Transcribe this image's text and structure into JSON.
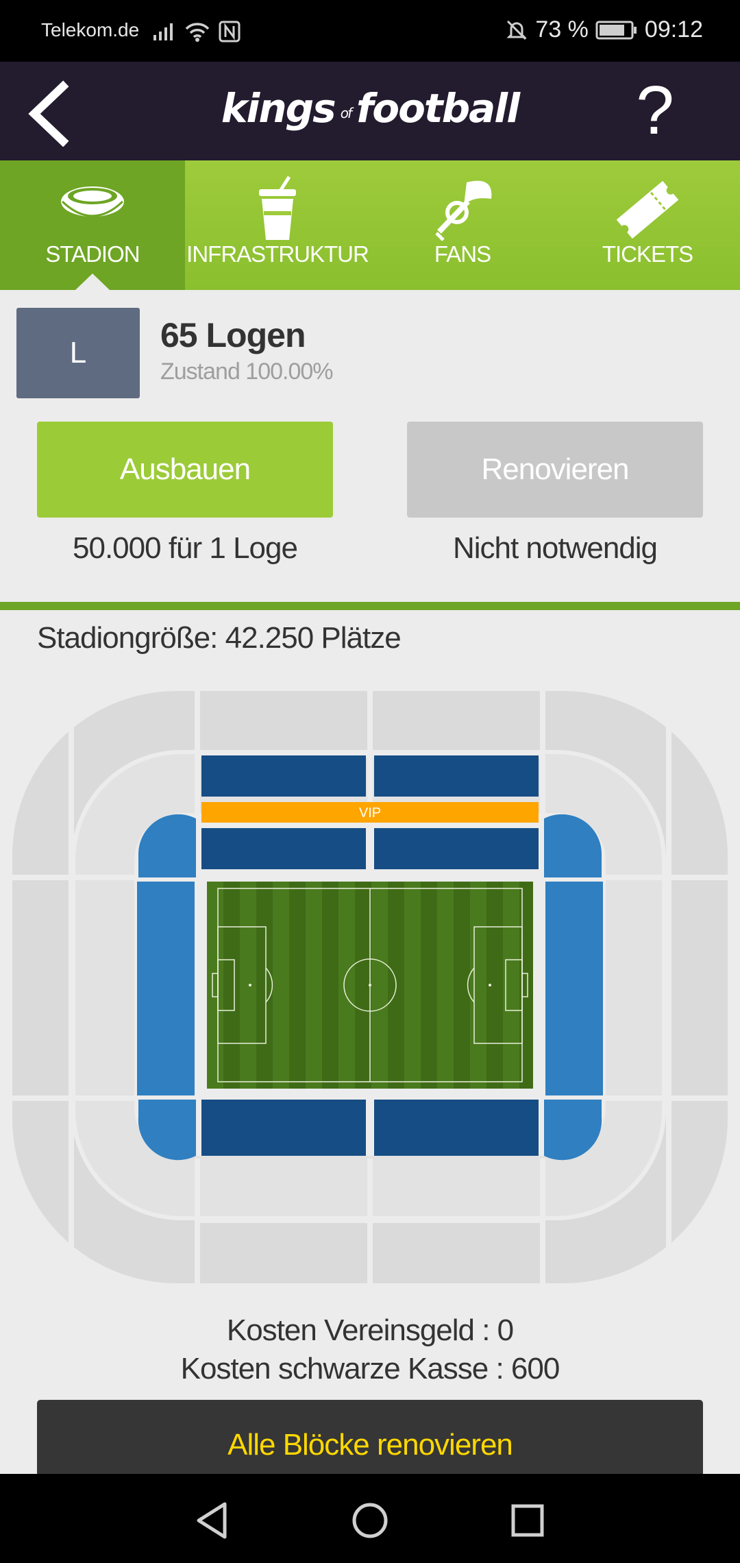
{
  "status_bar": {
    "carrier": "Telekom.de",
    "battery": "73 %",
    "time": "09:12",
    "icons": [
      "signal-icon",
      "wifi-icon",
      "nfc-icon",
      "mute-icon",
      "battery-icon"
    ]
  },
  "header": {
    "logo_part1": "kings",
    "logo_part2": "of",
    "logo_part3": "football",
    "help_label": "?"
  },
  "tabs": [
    {
      "label": "STADION",
      "icon": "stadium-icon",
      "active": true
    },
    {
      "label": "INFRASTRUKTUR",
      "icon": "drink-cup-icon",
      "active": false
    },
    {
      "label": "FANS",
      "icon": "trumpet-icon",
      "active": false
    },
    {
      "label": "TICKETS",
      "icon": "ticket-icon",
      "active": false
    }
  ],
  "item": {
    "badge": "L",
    "title": "65 Logen",
    "condition": "Zustand 100.00%"
  },
  "actions": {
    "upgrade_label": "Ausbauen",
    "upgrade_cost": "50.000 für 1 Loge",
    "renovate_label": "Renovieren",
    "renovate_cost": "Nicht notwendig"
  },
  "stadium": {
    "size_label": "Stadiongröße: 42.250 Plätze",
    "vip_label": "VIP"
  },
  "costs": {
    "club_money": "Kosten Vereinsgeld : 0",
    "black_money": "Kosten schwarze Kasse : 600"
  },
  "renovate_all_label": "Alle Blöcke renovieren",
  "colors": {
    "header_bg": "#231b2e",
    "tab_green": "#9ecb3b",
    "tab_active": "#6ea524",
    "upgrade_green": "#9ccb38",
    "stand_dark_blue": "#164d84",
    "stand_light_blue": "#2f7fc1",
    "vip_orange": "#ffa500",
    "renovate_all_text": "#ffd800"
  }
}
